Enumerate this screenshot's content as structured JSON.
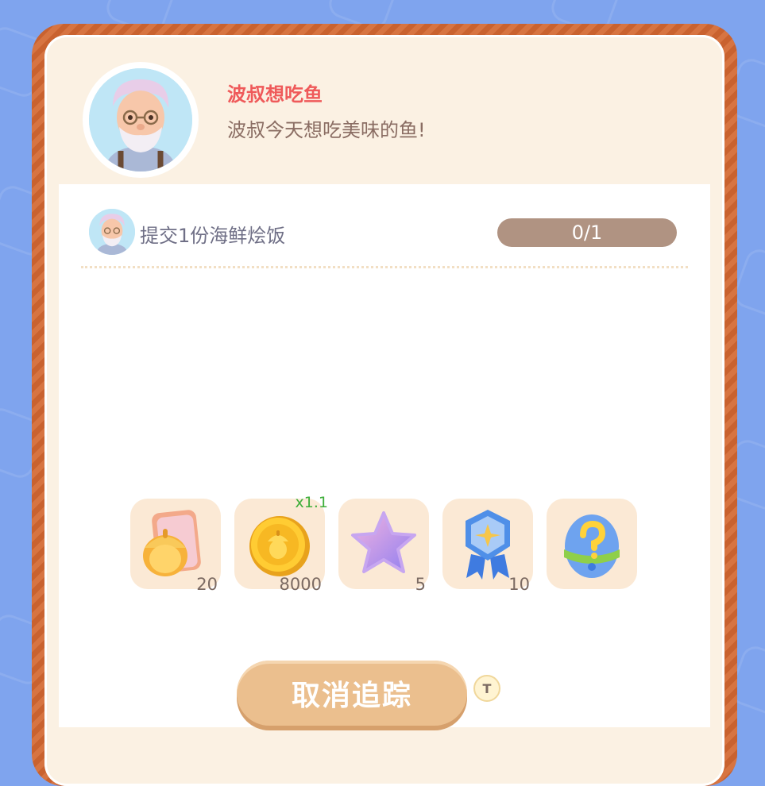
{
  "quest": {
    "title": "波叔想吃鱼",
    "description": "波叔今天想吃美味的鱼!"
  },
  "task": {
    "text": "提交1份海鲜烩饭",
    "progress": "0/1"
  },
  "rewards": [
    {
      "icon": "acorn-card-icon",
      "count": "20",
      "multiplier": ""
    },
    {
      "icon": "acorn-coin-icon",
      "count": "8000",
      "multiplier": "x1.1"
    },
    {
      "icon": "purple-star-icon",
      "count": "5",
      "multiplier": ""
    },
    {
      "icon": "blue-medal-icon",
      "count": "10",
      "multiplier": ""
    },
    {
      "icon": "mystery-egg-icon",
      "count": "",
      "multiplier": ""
    }
  ],
  "button": {
    "label": "取消追踪",
    "key": "T"
  },
  "colors": {
    "background": "#7fa4ee",
    "frame": "#c9622f",
    "title": "#ef5a5a",
    "button": "#ebbf8e"
  }
}
